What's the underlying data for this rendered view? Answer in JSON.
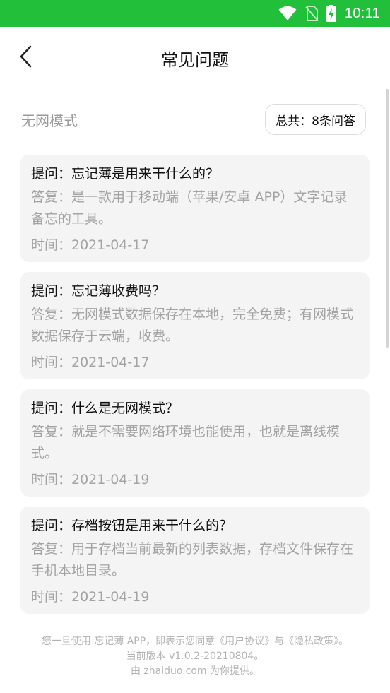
{
  "status_bar": {
    "time": "10:11",
    "icons": [
      "wifi-icon",
      "no-sim-icon",
      "battery-charging-icon"
    ],
    "background": "#22bf3a"
  },
  "nav": {
    "title": "常见问题",
    "back_icon": "chevron-left-icon"
  },
  "mode": {
    "label": "无网模式",
    "count": "总共：8条问答"
  },
  "faqs": [
    {
      "question": "提问：忘记薄是用来干什么的？",
      "answer": "答复：是一款用于移动端（苹果/安卓 APP）文字记录备忘的工具。",
      "time": "时间：2021-04-17"
    },
    {
      "question": "提问：忘记薄收费吗？",
      "answer": "答复：无网模式数据保存在本地，完全免费；有网模式数据保存于云端，收费。",
      "time": "时间：2021-04-17"
    },
    {
      "question": "提问：什么是无网模式？",
      "answer": "答复：就是不需要网络环境也能使用，也就是离线模式。",
      "time": "时间：2021-04-19"
    },
    {
      "question": "提问：存档按钮是用来干什么的？",
      "answer": "答复：用于存档当前最新的列表数据，存档文件保存在手机本地目录。",
      "time": "时间：2021-04-19"
    }
  ],
  "footer": {
    "line1": "您一旦使用 忘记薄 APP，即表示您同意《用户协议》与《隐私政策》。",
    "line2": "当前版本 v1.0.2-20210804。",
    "line3": "由 zhaiduo.com 为你提供。"
  }
}
